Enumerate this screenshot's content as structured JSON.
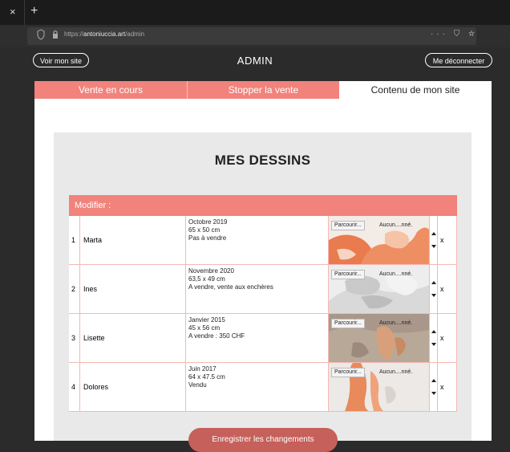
{
  "browser": {
    "url_prefix": "https://",
    "url_host": "antoniuccia.art",
    "url_path": "/admin",
    "tab_close": "×",
    "tab_new": "+",
    "toolbar_icons": "··· ⛉ ☆"
  },
  "header": {
    "left_button": "Voir mon site",
    "title": "ADMIN",
    "right_button": "Me déconnecter"
  },
  "nav": {
    "tabs": [
      "Vente en cours",
      "Stopper la vente",
      "Contenu de mon site"
    ]
  },
  "section": {
    "title": "MES DESSINS",
    "table_header": "Modifier :"
  },
  "rows": [
    {
      "num": "1",
      "name": "Marta",
      "date": "Octobre 2019",
      "size": "65 x 50 cm",
      "status": "Pas à vendre",
      "file_btn": "Parcourir...",
      "file_status": "Aucun....nné.",
      "delete": "x"
    },
    {
      "num": "2",
      "name": "Ines",
      "date": "Novembre 2020",
      "size": "63,5 x 49 cm",
      "status": "A vendre, vente aux enchères",
      "file_btn": "Parcourir...",
      "file_status": "Aucun....nné.",
      "delete": "x"
    },
    {
      "num": "3",
      "name": "Lisette",
      "date": "Janvier 2015",
      "size": "45 x 56 cm",
      "status": "A vendre : 350 CHF",
      "file_btn": "Parcourir...",
      "file_status": "Aucun....nné.",
      "delete": "x"
    },
    {
      "num": "4",
      "name": "Dolores",
      "date": "Juin 2017",
      "size": "64 x 47.5 cm",
      "status": "Vendu",
      "file_btn": "Parcourir...",
      "file_status": "Aucun....nné.",
      "delete": "x"
    }
  ],
  "save_button": "Enregistrer les changements",
  "colors": {
    "accent": "#f1837c",
    "save": "#c6605a",
    "chrome": "#2b2b2b"
  }
}
